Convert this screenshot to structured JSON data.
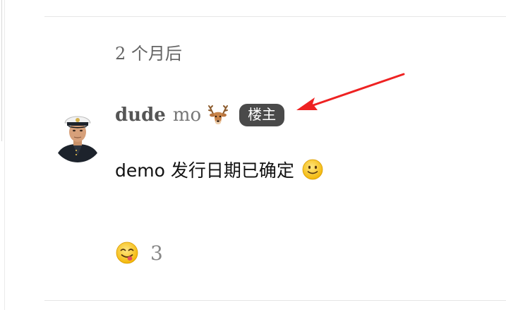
{
  "timeline": {
    "gap_label": "2 个月后"
  },
  "post": {
    "username": "dude",
    "fullname": "mo",
    "user_emoji_icon": "deer-face-icon",
    "op_badge": "楼主",
    "body_text": "demo 发行日期已确定",
    "body_emoji_icon": "slightly-smiling-face-icon",
    "avatar_icon": "user-avatar-captain",
    "reactions": [
      {
        "icon": "face-savoring-food-icon",
        "count": "3"
      }
    ]
  },
  "annotation": {
    "arrow_color": "#ee2222",
    "points_to": "op_badge"
  },
  "colors": {
    "badge_bg": "#4a4a4a",
    "divider": "#e6e6e6",
    "meta_text": "#646464"
  }
}
